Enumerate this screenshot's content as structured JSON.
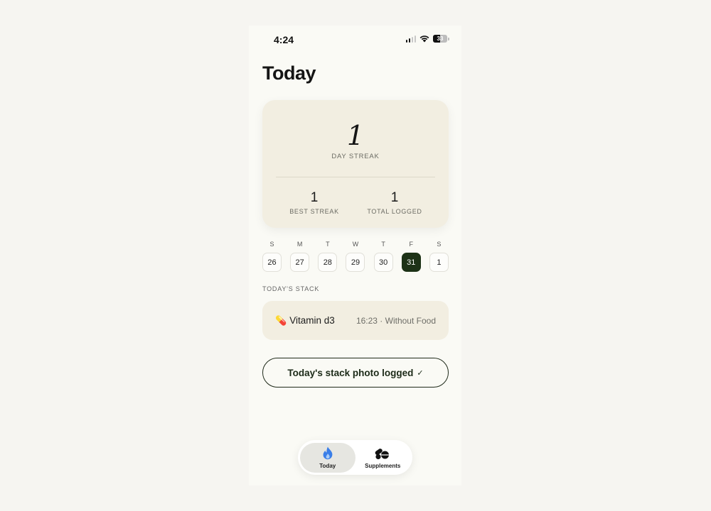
{
  "status_bar": {
    "time": "4:24",
    "battery": "33"
  },
  "page": {
    "title": "Today"
  },
  "streak_card": {
    "streak_value": "1",
    "streak_label": "DAY STREAK",
    "best_streak_value": "1",
    "best_streak_label": "BEST STREAK",
    "total_logged_value": "1",
    "total_logged_label": "TOTAL LOGGED"
  },
  "week": {
    "days": [
      {
        "letter": "S",
        "date": "26"
      },
      {
        "letter": "M",
        "date": "27"
      },
      {
        "letter": "T",
        "date": "28"
      },
      {
        "letter": "W",
        "date": "29"
      },
      {
        "letter": "T",
        "date": "30"
      },
      {
        "letter": "F",
        "date": "31"
      },
      {
        "letter": "S",
        "date": "1"
      }
    ],
    "selected_date": "31"
  },
  "stack": {
    "section_label": "TODAY'S STACK",
    "items": [
      {
        "icon": "pill-icon",
        "emoji": "💊",
        "name": "Vitamin d3",
        "meta": "16:23 · Without Food"
      }
    ]
  },
  "logged_button": {
    "label": "Today's stack photo logged",
    "check": "✓"
  },
  "tab_bar": {
    "tabs": [
      {
        "label": "Today",
        "icon": "flame-icon",
        "icon_color": "#3a7ee8",
        "active": true
      },
      {
        "label": "Supplements",
        "icon": "pills-icon",
        "icon_color": "#111111",
        "active": false
      }
    ]
  },
  "colors": {
    "card_bg": "#f2eee1",
    "accent_dark_green": "#1d3217",
    "page_bg": "#fafaf5"
  }
}
